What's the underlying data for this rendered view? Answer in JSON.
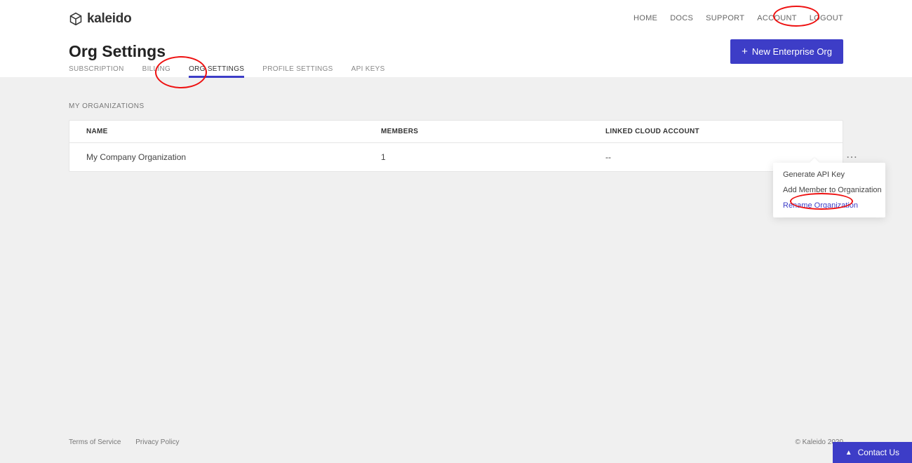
{
  "brand": {
    "name": "kaleido"
  },
  "topnav": {
    "items": [
      {
        "label": "HOME"
      },
      {
        "label": "DOCS"
      },
      {
        "label": "SUPPORT"
      },
      {
        "label": "ACCOUNT"
      },
      {
        "label": "LOGOUT"
      }
    ]
  },
  "page": {
    "title": "Org Settings",
    "new_org_label": "New Enterprise Org"
  },
  "tabs": {
    "items": [
      {
        "label": "SUBSCRIPTION",
        "active": false
      },
      {
        "label": "BILLING",
        "active": false
      },
      {
        "label": "ORG SETTINGS",
        "active": true
      },
      {
        "label": "PROFILE SETTINGS",
        "active": false
      },
      {
        "label": "API KEYS",
        "active": false
      }
    ]
  },
  "orgs": {
    "section_label": "MY ORGANIZATIONS",
    "columns": {
      "name": "NAME",
      "members": "MEMBERS",
      "linked": "LINKED CLOUD ACCOUNT"
    },
    "rows": [
      {
        "name": "My Company Organization",
        "members": "1",
        "linked": "--"
      }
    ]
  },
  "row_menu": {
    "items": [
      {
        "label": "Generate API Key",
        "link": false
      },
      {
        "label": "Add Member to Organization",
        "link": false
      },
      {
        "label": "Rename Organization",
        "link": true
      }
    ]
  },
  "footer": {
    "tos": "Terms of Service",
    "privacy": "Privacy Policy",
    "copyright": "© Kaleido 2020",
    "contact": "Contact Us"
  }
}
